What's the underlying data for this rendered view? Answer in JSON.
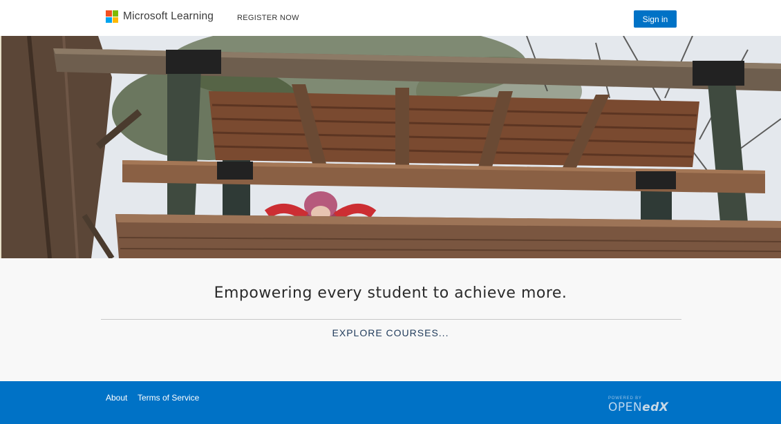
{
  "header": {
    "brand": "Microsoft Learning",
    "logo_colors": [
      "#f25022",
      "#7fba00",
      "#00a4ef",
      "#ffb900"
    ],
    "register_label": "REGISTER NOW",
    "signin_label": "Sign in"
  },
  "hero": {
    "image": "children-treehouse-photo"
  },
  "main": {
    "tagline": "Empowering every student to achieve more.",
    "explore_label": "EXPLORE COURSES..."
  },
  "footer": {
    "links": [
      "About",
      "Terms of Service"
    ],
    "powered_by": "POWERED BY",
    "platform_prefix": "OPEN",
    "platform_suffix": "edX"
  },
  "colors": {
    "accent": "#0072c6",
    "main_bg": "#f8f8f8"
  }
}
